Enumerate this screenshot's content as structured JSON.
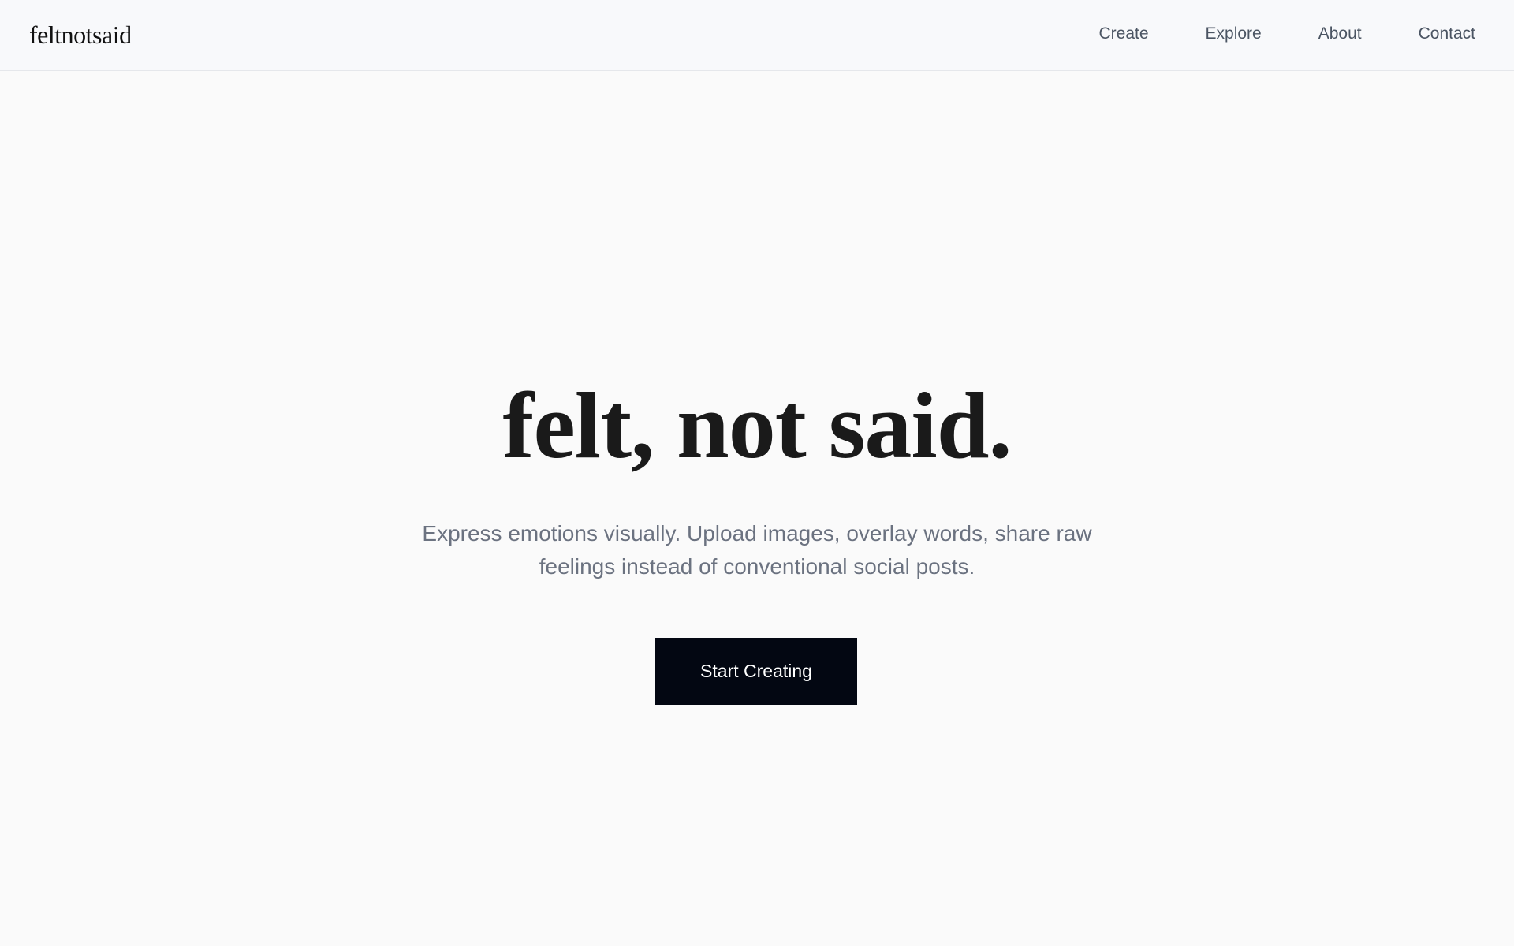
{
  "header": {
    "logo": "feltnotsaid",
    "nav": [
      {
        "label": "Create"
      },
      {
        "label": "Explore"
      },
      {
        "label": "About"
      },
      {
        "label": "Contact"
      }
    ]
  },
  "hero": {
    "title": "felt, not said.",
    "subtitle": "Express emotions visually. Upload images, overlay words, share raw feelings instead of conventional social posts.",
    "cta_label": "Start Creating"
  },
  "colors": {
    "background": "#fafafa",
    "header_background": "#f8f9fb",
    "button_background": "#030712",
    "title": "#1a1a1a",
    "subtitle": "#6b7280"
  }
}
